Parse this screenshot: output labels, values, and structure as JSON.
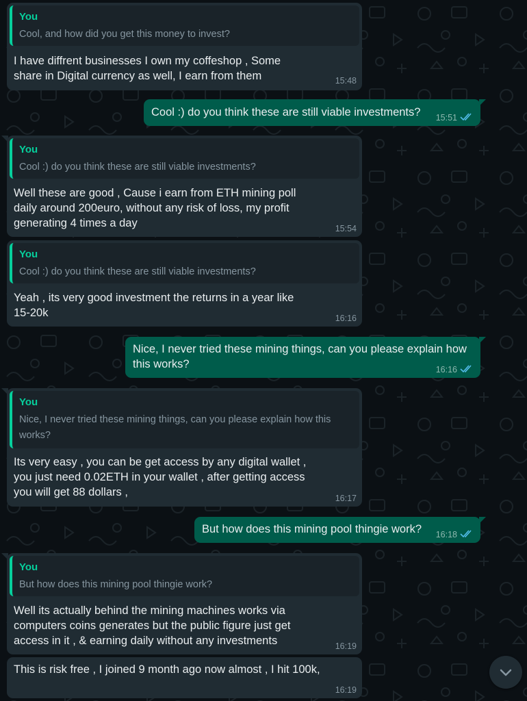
{
  "messages": [
    {
      "quote_author": "You",
      "quote_text": "Cool, and how did you get this money to invest?",
      "text": "I have diffrent businesses I own my coffeshop , Some share in Digital currency as well, I earn from them",
      "time": "15:48"
    },
    {
      "text": "Cool :) do you think these are still viable investments?",
      "time": "15:51"
    },
    {
      "quote_author": "You",
      "quote_text": "Cool :) do you think these are still viable investments?",
      "text": "Well these are good , Cause i earn from ETH mining poll daily around 200euro, without any risk of loss, my profit generating 4 times a day",
      "time": "15:54"
    },
    {
      "quote_author": "You",
      "quote_text": "Cool :) do you think these are still viable investments?",
      "text": "Yeah , its very good investment the returns in a year like 15-20k",
      "time": "16:16"
    },
    {
      "text": "Nice, I never tried these mining things, can you please explain how this works?",
      "time": "16:16"
    },
    {
      "quote_author": "You",
      "quote_text": "Nice, I never tried these mining things, can you please explain how this works?",
      "text": "Its very easy , you can be get access by any digital wallet , you just need 0.02ETH in your wallet , after getting access you will get 88 dollars ,",
      "time": "16:17"
    },
    {
      "text": "But how does this mining pool thingie work?",
      "time": "16:18"
    },
    {
      "quote_author": "You",
      "quote_text": "But how does this mining pool thingie work?",
      "text": "Well its actually behind the mining machines works via computers coins generates but the public figure just get access in it , & earning daily without  any investments",
      "time": "16:19"
    },
    {
      "text": "This is risk free , I joined  9 month ago now almost , I hit 100k,",
      "time": "16:19"
    }
  ],
  "icons": {
    "read_receipt": "double-check-icon",
    "scroll_down": "chevron-down-icon"
  },
  "colors": {
    "background": "#0b1014",
    "incoming_bubble": "#202c33",
    "outgoing_bubble": "#005c4b",
    "quote_accent": "#06cf9c",
    "read_tick": "#53bdeb"
  }
}
